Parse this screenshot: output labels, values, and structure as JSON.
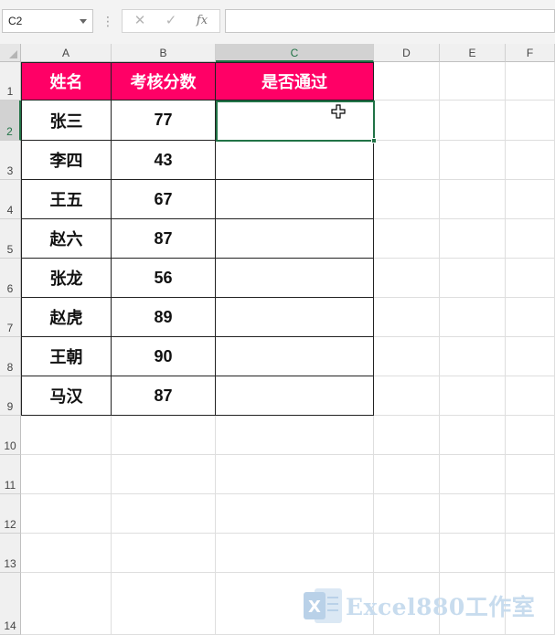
{
  "formula_bar": {
    "name_box": "C2",
    "cancel_icon": "✕",
    "confirm_icon": "✓",
    "fx_label": "fx",
    "formula_value": ""
  },
  "columns": [
    "A",
    "B",
    "C",
    "D",
    "E",
    "F"
  ],
  "rows": [
    "1",
    "2",
    "3",
    "4",
    "5",
    "6",
    "7",
    "8",
    "9",
    "10",
    "11",
    "12",
    "13",
    "14"
  ],
  "selected_cell": "C2",
  "table": {
    "headers": [
      "姓名",
      "考核分数",
      "是否通过"
    ],
    "header_color": "#ff0066",
    "rows": [
      {
        "name": "张三",
        "score": "77",
        "pass": ""
      },
      {
        "name": "李四",
        "score": "43",
        "pass": ""
      },
      {
        "name": "王五",
        "score": "67",
        "pass": ""
      },
      {
        "name": "赵六",
        "score": "87",
        "pass": ""
      },
      {
        "name": "张龙",
        "score": "56",
        "pass": ""
      },
      {
        "name": "赵虎",
        "score": "89",
        "pass": ""
      },
      {
        "name": "王朝",
        "score": "90",
        "pass": ""
      },
      {
        "name": "马汉",
        "score": "87",
        "pass": ""
      }
    ]
  },
  "watermark": {
    "logo_text": "X",
    "text": "Excel880工作室"
  },
  "colors": {
    "accent": "#217346",
    "header_fill": "#ff0066",
    "watermark": "#c8dcee"
  }
}
